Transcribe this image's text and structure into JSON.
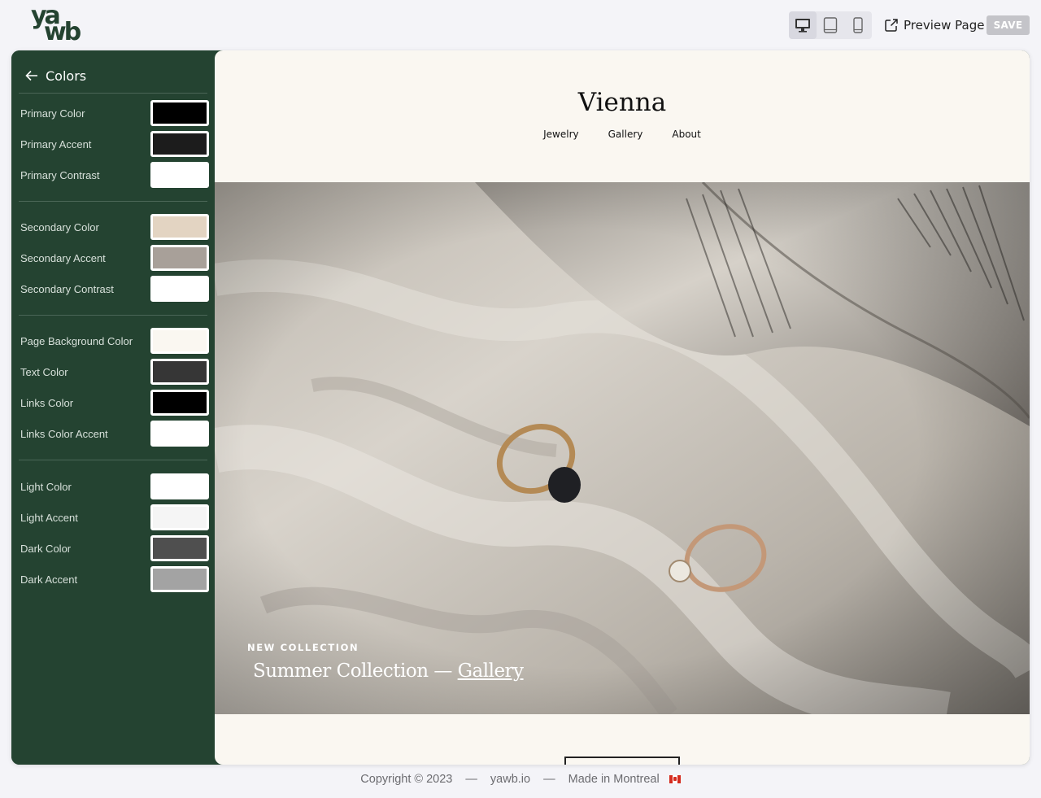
{
  "app": {
    "logo_top": "ya",
    "logo_bottom": "wb"
  },
  "toolbar": {
    "devices": [
      "desktop-icon",
      "tablet-icon",
      "mobile-icon"
    ],
    "active_device": "desktop",
    "preview_label": "Preview Page",
    "save_label": "SAVE"
  },
  "sidebar": {
    "title": "Colors",
    "groups": [
      [
        {
          "label": "Primary Color",
          "color": "#000000"
        },
        {
          "label": "Primary Accent",
          "color": "#1c1c1c"
        },
        {
          "label": "Primary Contrast",
          "color": "#ffffff"
        }
      ],
      [
        {
          "label": "Secondary Color",
          "color": "#e3d4c2"
        },
        {
          "label": "Secondary Accent",
          "color": "#a8a099"
        },
        {
          "label": "Secondary Contrast",
          "color": "#ffffff"
        }
      ],
      [
        {
          "label": "Page Background Color",
          "color": "#faf7f1"
        },
        {
          "label": "Text Color",
          "color": "#363636"
        },
        {
          "label": "Links Color",
          "color": "#000000"
        },
        {
          "label": "Links Color Accent",
          "color": "#ffffff"
        }
      ],
      [
        {
          "label": "Light Color",
          "color": "#ffffff"
        },
        {
          "label": "Light Accent",
          "color": "#f5f5f5"
        },
        {
          "label": "Dark Color",
          "color": "#4f4f4f"
        },
        {
          "label": "Dark Accent",
          "color": "#a3a3a3"
        }
      ]
    ]
  },
  "site": {
    "title": "Vienna",
    "nav": [
      "Jewelry",
      "Gallery",
      "About"
    ],
    "hero": {
      "kicker": "NEW COLLECTION",
      "headline": "Summer Collection — ",
      "headline_link": "Gallery"
    }
  },
  "footer": {
    "copyright": "Copyright © 2023",
    "sep": "—",
    "site": "yawb.io",
    "made_in": "Made in Montreal"
  },
  "colors": {
    "brand_green": "#244331",
    "page_bg": "#f4f4f8",
    "preview_bg": "#faf7f1"
  }
}
